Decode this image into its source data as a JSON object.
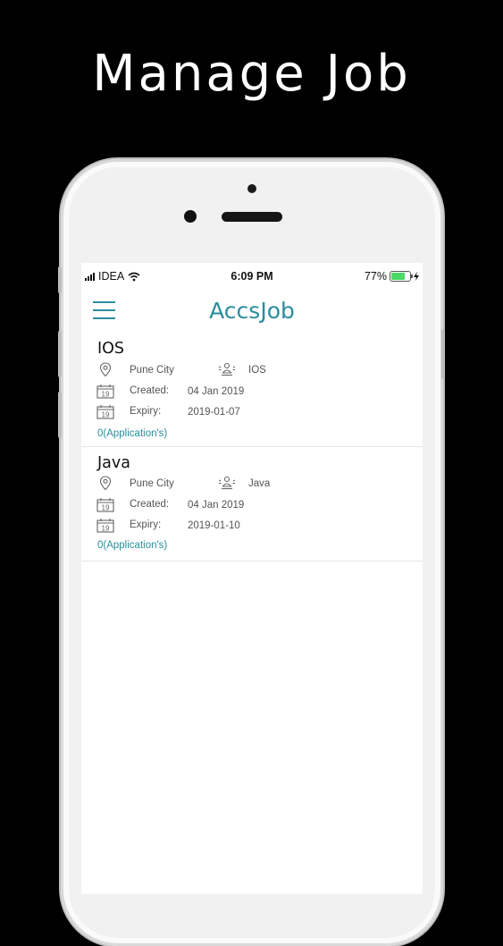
{
  "headline": "Manage Job",
  "status_bar": {
    "carrier": "IDEA",
    "time": "6:09 PM",
    "battery_percent": "77%",
    "battery_level": 0.77
  },
  "app_bar": {
    "title": "AccsJob",
    "accent_color": "#2a8e9e"
  },
  "jobs": [
    {
      "title": "IOS",
      "location": "Pune City",
      "skill": "IOS",
      "created_label": "Created:",
      "created": "04 Jan 2019",
      "expiry_label": "Expiry:",
      "expiry": "2019-01-07",
      "applications": "0(Application's)"
    },
    {
      "title": "Java",
      "location": "Pune City",
      "skill": "Java",
      "created_label": "Created:",
      "created": "04 Jan 2019",
      "expiry_label": "Expiry:",
      "expiry": "2019-01-10",
      "applications": "0(Application's)"
    }
  ]
}
